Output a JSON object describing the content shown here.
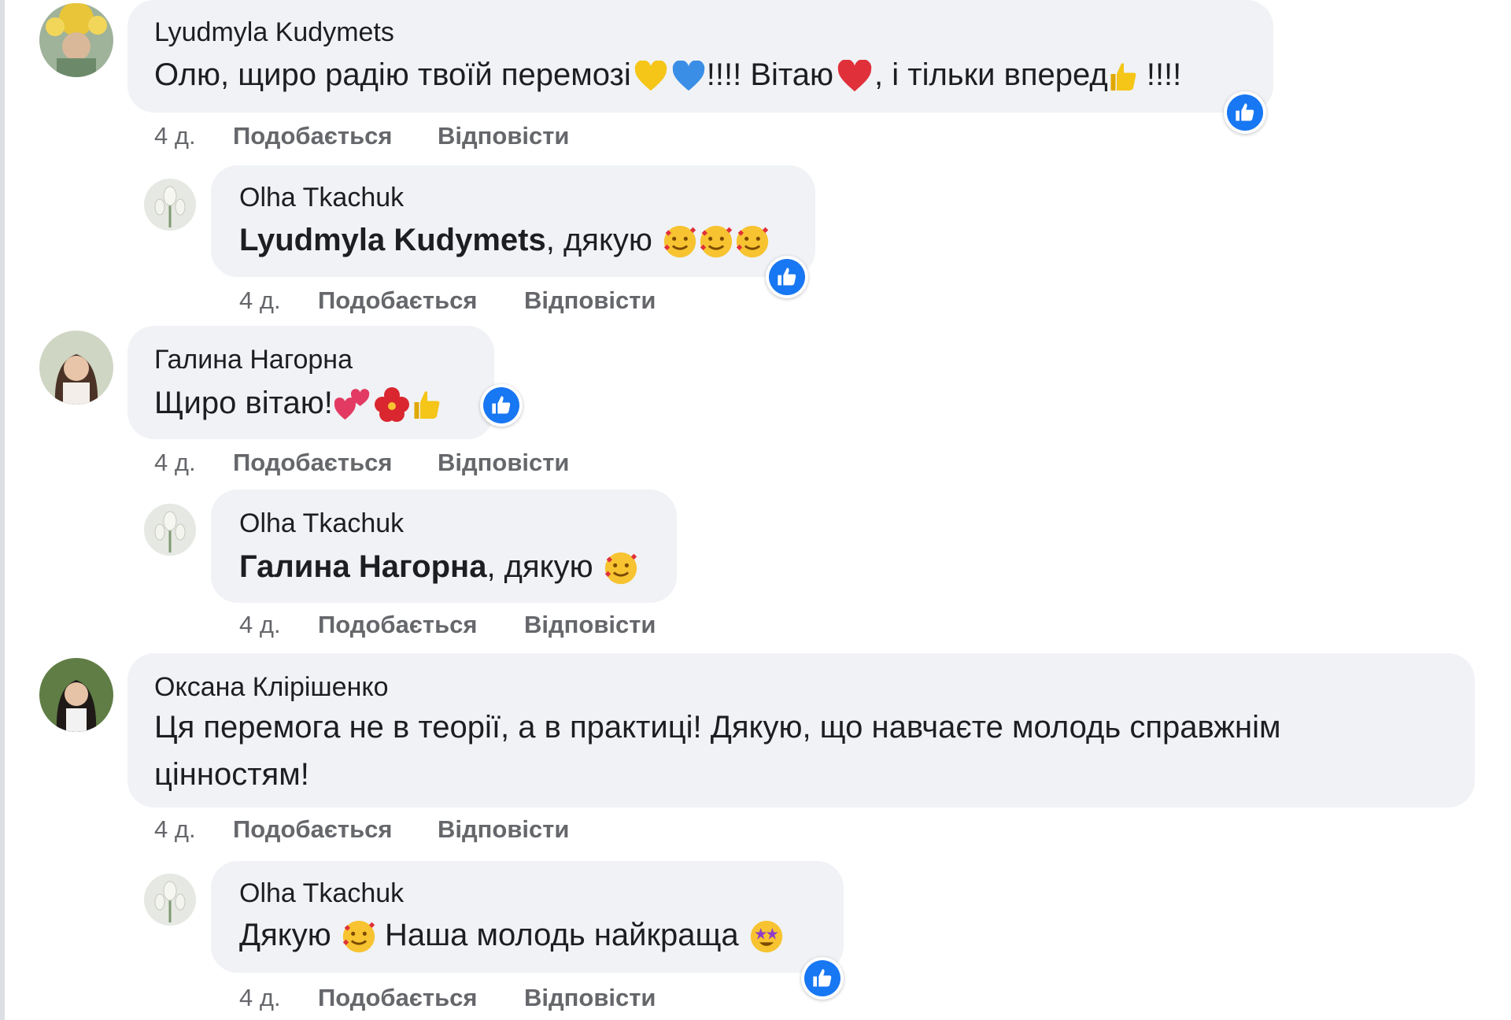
{
  "comments": [
    {
      "author": "Lyudmyla Kudymets",
      "text": "Олю, щиро радію твоїй перемозі",
      "text_parts": [
        "Олю, щиро радію твоїй перемозі",
        "!!!! Вітаю",
        ", і тільки вперед",
        " !!!!"
      ],
      "time": "4 д.",
      "like": "Подобається",
      "reply": "Відповісти",
      "avatar": "yellow-flower-avatar",
      "reply_item": {
        "author": "Olha Tkachuk",
        "mention": "Lyudmyla Kudymets",
        "text": ", дякую",
        "time": "4 д.",
        "like": "Подобається",
        "reply": "Відповісти"
      }
    },
    {
      "author": "Галина Нагорна",
      "text": "Щиро вітаю!",
      "time": "4 д.",
      "like": "Подобається",
      "reply": "Відповісти",
      "reply_item": {
        "author": "Olha Tkachuk",
        "mention": "Галина Нагорна",
        "text": ", дякую",
        "time": "4 д.",
        "like": "Подобається",
        "reply": "Відповісти"
      }
    },
    {
      "author": "Оксана Клірішенко",
      "text_line1": "Ця перемога не в теорії, а в практиці! Дякую, що навчаєте молодь справжнім",
      "text_line2": "цінностям!",
      "time": "4 д.",
      "like": "Подобається",
      "reply": "Відповісти",
      "reply_item": {
        "author": "Olha Tkachuk",
        "text_a": "Дякую",
        "text_b": " Наша молодь найкраща",
        "time": "4 д.",
        "like": "Подобається",
        "reply": "Відповісти"
      }
    }
  ],
  "colors": {
    "bubble": "#f0f2f5",
    "like_blue": "#1877f2",
    "meta_gray": "#65676b",
    "text": "#1c1e21"
  },
  "icons": {
    "like_badge": "thumbs-up-icon",
    "emoji": [
      "yellow-heart",
      "blue-heart",
      "red-heart",
      "thumbs-up",
      "smiling-face-with-hearts",
      "two-hearts",
      "hibiscus",
      "star-struck"
    ]
  }
}
